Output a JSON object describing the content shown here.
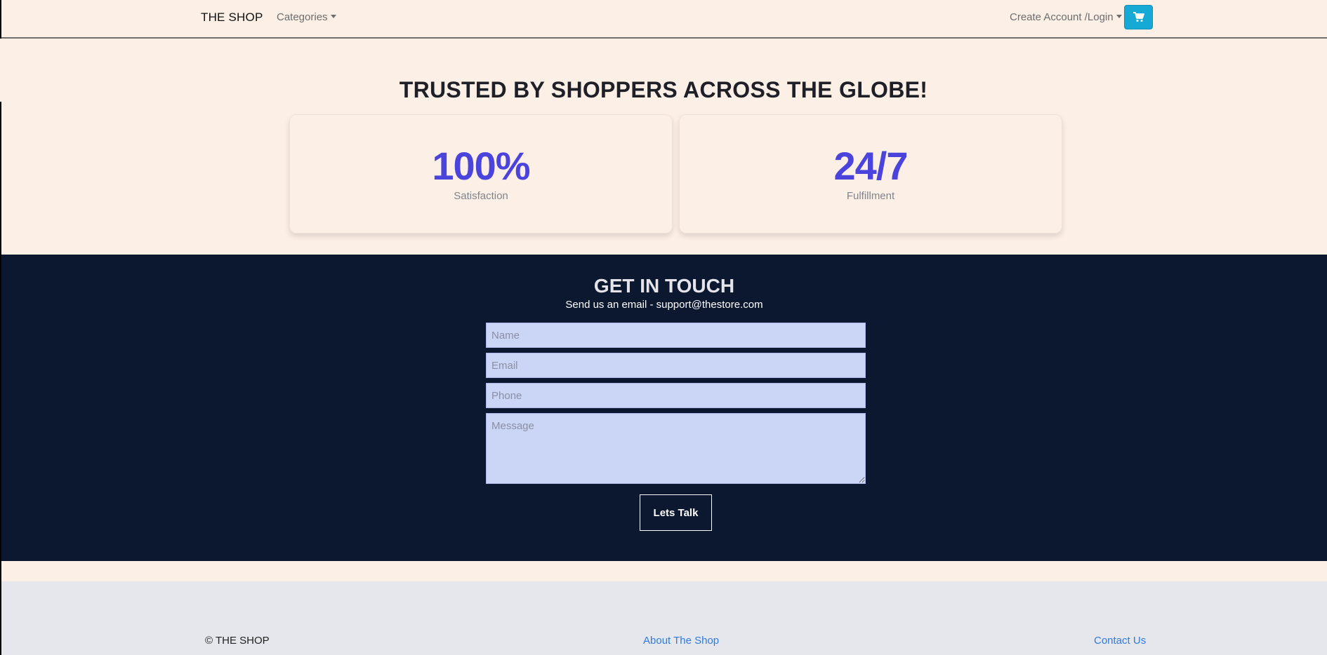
{
  "navbar": {
    "brand": "THE SHOP",
    "categories_label": "Categories",
    "account_label": "Create Account /Login",
    "cart_icon": "cart-icon"
  },
  "trust": {
    "title": "TRUSTED BY SHOPPERS ACROSS THE GLOBE!",
    "stats": [
      {
        "value": "100%",
        "label": "Satisfaction"
      },
      {
        "value": "24/7",
        "label": "Fulfillment"
      }
    ]
  },
  "contact": {
    "title": "GET IN TOUCH",
    "subtitle": "Send us an email - support@thestore.com",
    "name_placeholder": "Name",
    "email_placeholder": "Email",
    "phone_placeholder": "Phone",
    "message_placeholder": "Message",
    "submit_label": "Lets Talk"
  },
  "footer": {
    "copyright": "© THE SHOP",
    "about_label": "About The Shop",
    "contact_label": "Contact Us"
  },
  "colors": {
    "page_bg": "#fcefe6",
    "stat_accent": "#4b44dc",
    "contact_bg": "#0c1730",
    "input_bg": "#cbd5f6",
    "cart_button": "#17a9d6",
    "footer_bg": "#e5e7ec",
    "link": "#2f7be0"
  }
}
